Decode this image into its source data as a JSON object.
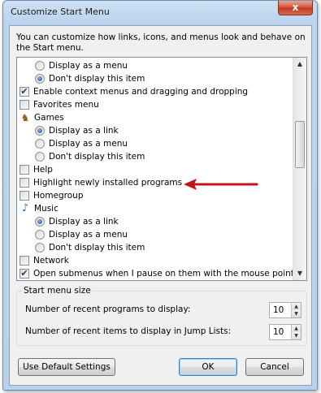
{
  "window": {
    "title": "Customize Start Menu",
    "close_glyph": "x"
  },
  "description": "You can customize how links, icons, and menus look and behave on the Start menu.",
  "list": [
    {
      "type": "radio",
      "level": 1,
      "label": "Display as a menu",
      "selected": false
    },
    {
      "type": "radio",
      "level": 1,
      "label": "Don't display this item",
      "selected": true
    },
    {
      "type": "checkbox",
      "level": 0,
      "label": "Enable context menus and dragging and dropping",
      "checked": true
    },
    {
      "type": "checkbox",
      "level": 0,
      "label": "Favorites menu",
      "checked": false
    },
    {
      "type": "heading",
      "level": 0,
      "icon": "games-icon",
      "label": "Games"
    },
    {
      "type": "radio",
      "level": 1,
      "label": "Display as a link",
      "selected": true
    },
    {
      "type": "radio",
      "level": 1,
      "label": "Display as a menu",
      "selected": false
    },
    {
      "type": "radio",
      "level": 1,
      "label": "Don't display this item",
      "selected": false
    },
    {
      "type": "checkbox",
      "level": 0,
      "label": "Help",
      "checked": false
    },
    {
      "type": "checkbox",
      "level": 0,
      "label": "Highlight newly installed programs",
      "checked": false
    },
    {
      "type": "checkbox",
      "level": 0,
      "label": "Homegroup",
      "checked": false
    },
    {
      "type": "heading",
      "level": 0,
      "icon": "music-icon",
      "label": "Music"
    },
    {
      "type": "radio",
      "level": 1,
      "label": "Display as a link",
      "selected": true
    },
    {
      "type": "radio",
      "level": 1,
      "label": "Display as a menu",
      "selected": false
    },
    {
      "type": "radio",
      "level": 1,
      "label": "Don't display this item",
      "selected": false
    },
    {
      "type": "checkbox",
      "level": 0,
      "label": "Network",
      "checked": false
    },
    {
      "type": "checkbox",
      "level": 0,
      "label": "Open submenus when I pause on them with the mouse pointer",
      "checked": true
    }
  ],
  "start_menu_size": {
    "title": "Start menu size",
    "recent_programs_label": "Number of recent programs to display:",
    "recent_programs_value": "10",
    "jump_list_label": "Number of recent items to display in Jump Lists:",
    "jump_list_value": "10"
  },
  "buttons": {
    "default_settings": "Use Default Settings",
    "ok": "OK",
    "cancel": "Cancel"
  },
  "annotation": {
    "arrow_color": "#c0141b"
  },
  "icons": {
    "check": "✔",
    "up": "▲",
    "down": "▼",
    "games": "♞",
    "music": "♪"
  }
}
